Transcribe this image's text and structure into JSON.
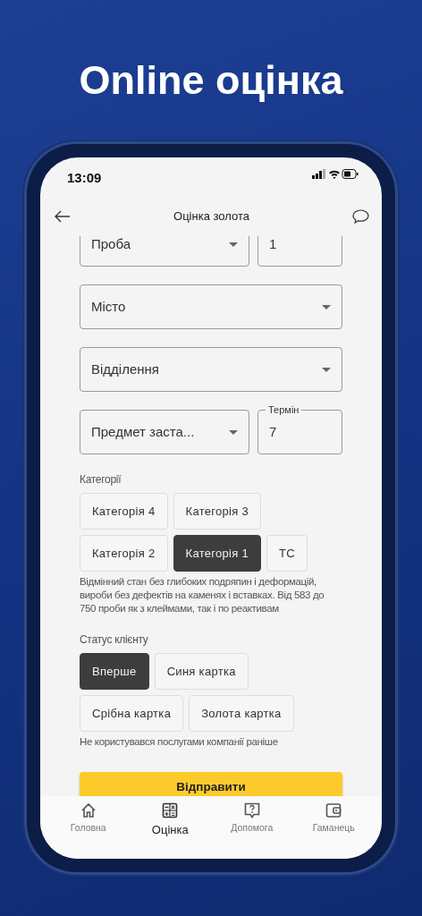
{
  "headline": "Online оцінка",
  "status_bar": {
    "time": "13:09"
  },
  "header": {
    "title": "Оцінка золота"
  },
  "form_rows": [
    [
      {
        "kind": "select",
        "text": "Проба"
      },
      {
        "kind": "input",
        "value": "1"
      }
    ],
    [
      {
        "kind": "select",
        "text": "Місто"
      }
    ],
    [
      {
        "kind": "select",
        "text": "Відділення"
      }
    ],
    [
      {
        "kind": "select",
        "text": "Предмет заста..."
      },
      {
        "kind": "input",
        "label": "Термін",
        "value": "7"
      }
    ]
  ],
  "categories": {
    "label": "Категорії",
    "options": [
      {
        "label": "Категорія 4",
        "selected": false
      },
      {
        "label": "Категорія 3",
        "selected": false
      },
      {
        "label": "Категорія 2",
        "selected": false
      },
      {
        "label": "Категорія 1",
        "selected": true
      },
      {
        "label": "ТС",
        "selected": false
      }
    ],
    "description": "Відмінний стан без глибоких подряпин і деформацій, вироби без дефектів на каменях і вставках. Від 583 до 750 проби як з клеймами, так і по реактивам"
  },
  "client_status": {
    "label": "Статус клієнту",
    "options": [
      {
        "label": "Вперше",
        "selected": true
      },
      {
        "label": "Синя картка",
        "selected": false
      },
      {
        "label": "Срібна картка",
        "selected": false
      },
      {
        "label": "Золота картка",
        "selected": false
      }
    ],
    "description": "Не користувався послугами компанії раніше"
  },
  "submit": "Відправити",
  "tab_bar": [
    {
      "label": "Головна",
      "selected": false
    },
    {
      "label": "Оцінка",
      "selected": true
    },
    {
      "label": "Допомога",
      "selected": false
    },
    {
      "label": "Гаманець",
      "selected": false
    }
  ]
}
